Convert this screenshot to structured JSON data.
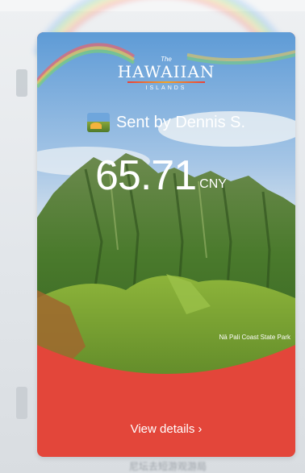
{
  "background": {
    "ghost_text": "",
    "bottom_text": "尼坛去短游观游局"
  },
  "card": {
    "brand": {
      "the": "The",
      "name": "HAWAIIAN",
      "sub": "ISLANDS"
    },
    "sender_label": "Sent by Dennis S.",
    "amount": {
      "value": "65.71",
      "currency": "CNY"
    },
    "photo_caption": "Nā Pali Coast State Park",
    "details_label": "View details",
    "details_chevron": "›",
    "colors": {
      "card_red": "#e3463a",
      "sky_top": "#6aa3d8",
      "mountain_green": "#4f7f2e"
    }
  }
}
